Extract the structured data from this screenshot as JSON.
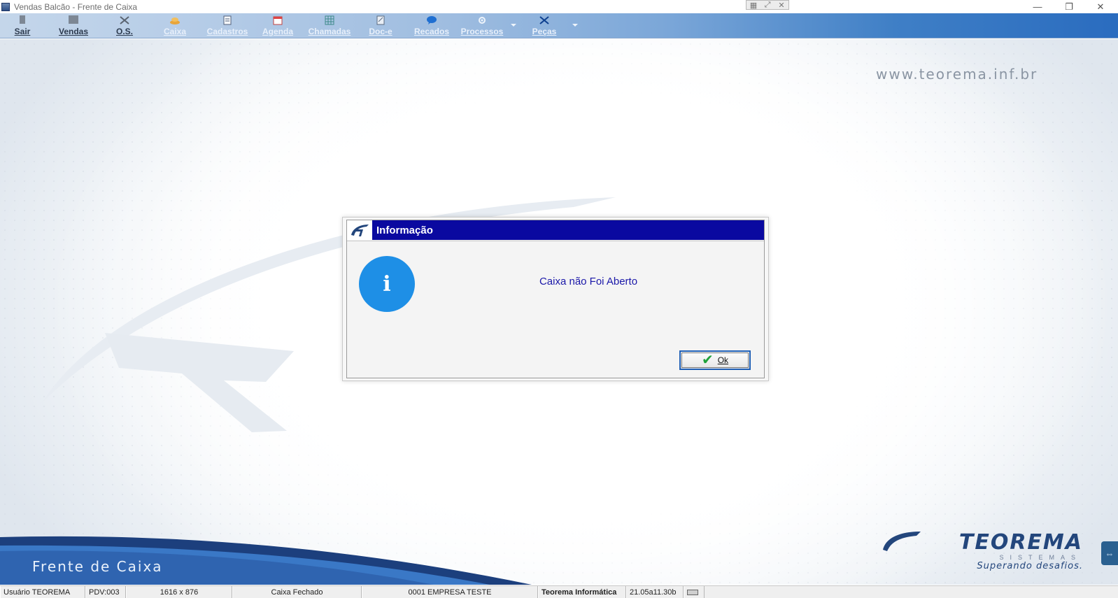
{
  "window": {
    "title": "Vendas Balcão - Frente de Caixa",
    "controls": {
      "minimize": "—",
      "restore": "❐",
      "close": "✕"
    },
    "mini_tools": [
      "▦",
      "⤢",
      "✕"
    ]
  },
  "toolbar": {
    "items": [
      {
        "label": "Sair",
        "icon": "exit-icon"
      },
      {
        "label": "Vendas",
        "icon": "sales-icon"
      },
      {
        "label": "O.S.",
        "icon": "tools-icon"
      },
      {
        "label": "Caixa",
        "icon": "cash-icon"
      },
      {
        "label": "Cadastros",
        "icon": "registry-icon"
      },
      {
        "label": "Agenda",
        "icon": "calendar-icon"
      },
      {
        "label": "Chamadas",
        "icon": "grid-icon"
      },
      {
        "label": "Doc-e",
        "icon": "document-icon"
      },
      {
        "label": "Recados",
        "icon": "message-icon"
      },
      {
        "label": "Processos",
        "icon": "gear-icon"
      },
      {
        "label": "Peças",
        "icon": "wrench-icon"
      }
    ]
  },
  "background": {
    "url": "www.teorema.inf.br",
    "footer_label": "Frente de Caixa",
    "brand_name": "TEOREMA",
    "brand_sub": "SISTEMAS",
    "brand_slogan": "Superando desafios."
  },
  "dialog": {
    "title": "Informação",
    "message": "Caixa não Foi Aberto",
    "ok_label": "Ok",
    "icon_glyph": "i"
  },
  "statusbar": {
    "user": "Usuário TEOREMA",
    "pdv": "PDV:003",
    "resolution": "1616 x 876",
    "cash_status": "Caixa Fechado",
    "company": "0001 EMPRESA TESTE",
    "vendor": "Teorema Informática",
    "version": "21.05a11.30b"
  },
  "colors": {
    "dialog_header": "#0a09a0",
    "info_icon": "#1e8fe6",
    "message_text": "#1a17a8",
    "brand": "#23467c"
  }
}
